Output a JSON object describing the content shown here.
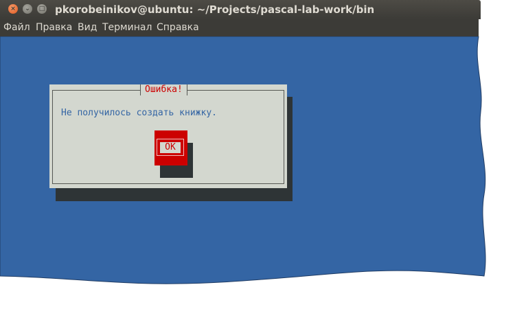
{
  "window": {
    "title": "pkorobeinikov@ubuntu: ~/Projects/pascal-lab-work/bin",
    "buttons": {
      "close_glyph": "×",
      "minimize_glyph": "⌄",
      "maximize_glyph": "□"
    }
  },
  "menubar": {
    "items": [
      "Файл",
      "Правка",
      "Вид",
      "Терминал",
      "Справка"
    ]
  },
  "dialog": {
    "title": "Ошибка!",
    "message": "Не получилось создать книжку.",
    "ok_label": "OK"
  },
  "colors": {
    "terminal_background": "#3465a4",
    "dialog_background": "#d3d7cf",
    "dialog_shadow": "#2e3436",
    "error_red": "#cc0000",
    "message_blue": "#3465a4",
    "titlebar": "#3c3b37"
  }
}
